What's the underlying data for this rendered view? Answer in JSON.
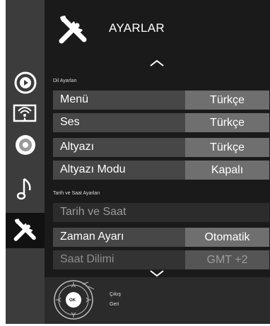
{
  "header": {
    "title": "AYARLAR"
  },
  "sections": {
    "language": "Dil Ayarları",
    "datetime": "Tarih ve Saat Ayarları"
  },
  "rows": {
    "menu": {
      "label": "Menü",
      "value": "Türkçe"
    },
    "audio": {
      "label": "Ses",
      "value": "Türkçe"
    },
    "subtitle": {
      "label": "Altyazı",
      "value": "Türkçe"
    },
    "subtitle_mode": {
      "label": "Altyazı Modu",
      "value": "Kapalı"
    },
    "date_time": {
      "label": "Tarih ve Saat"
    },
    "time_setting": {
      "label": "Zaman Ayarı",
      "value": "Otomatik"
    },
    "time_zone": {
      "label": "Saat Dilimi",
      "value": "GMT +2"
    }
  },
  "footer": {
    "ok": "OK",
    "exit": "Çıkış",
    "back": "Geri"
  },
  "sidebar": {
    "items": [
      "source-icon",
      "picture-settings-icon",
      "disc-icon",
      "music-note-icon",
      "settings-tools-icon"
    ]
  }
}
